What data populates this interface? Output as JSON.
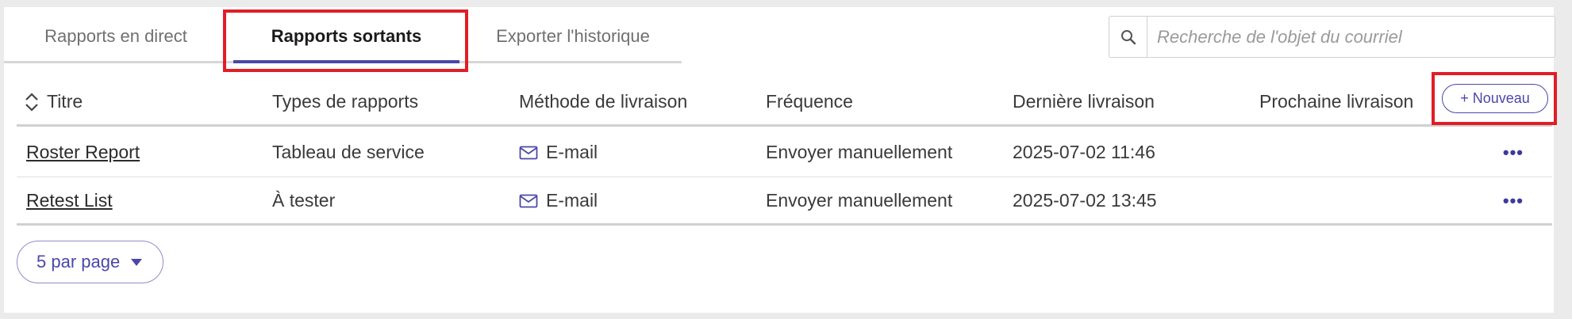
{
  "tabs": [
    {
      "label": "Rapports en direct"
    },
    {
      "label": "Rapports sortants"
    },
    {
      "label": "Exporter l'historique"
    }
  ],
  "search": {
    "placeholder": "Recherche de l'objet du courriel",
    "icon": "search-icon"
  },
  "table": {
    "columns": [
      "Titre",
      "Types de rapports",
      "Méthode de livraison",
      "Fréquence",
      "Dernière livraison",
      "Prochaine livraison"
    ],
    "new_button": "+ Nouveau",
    "rows": [
      {
        "title": "Roster Report",
        "type": "Tableau de service",
        "method": "E-mail",
        "frequency": "Envoyer manuellement",
        "last": "2025-07-02 11:46",
        "next": "",
        "menu": "•••"
      },
      {
        "title": "Retest List",
        "type": "À tester",
        "method": "E-mail",
        "frequency": "Envoyer manuellement",
        "last": "2025-07-02 13:45",
        "next": "",
        "menu": "•••"
      }
    ]
  },
  "pagination": {
    "per_page_label": "5 par page"
  },
  "colors": {
    "accent": "#4b47a8",
    "highlight": "#e01e26"
  }
}
